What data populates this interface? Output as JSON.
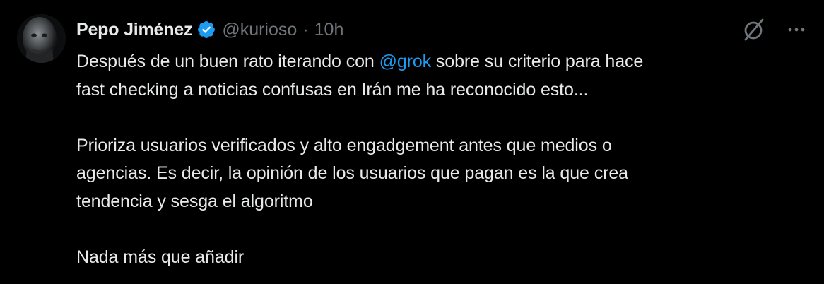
{
  "author": {
    "name": "Pepo Jiménez",
    "handle": "@kurioso",
    "separator": "·",
    "time": "10h"
  },
  "icons": {
    "avatar": "avatar-photo",
    "verified": "verified-badge-icon",
    "grok": "grok-icon",
    "more": "more-icon"
  },
  "colors": {
    "background": "#000000",
    "text": "#e7e9ea",
    "secondary": "#71767b",
    "accent": "#1d9bf0"
  },
  "tweet": {
    "p1_line1_before": "Después de un buen rato iterando con ",
    "p1_mention": "@grok",
    "p1_line1_after": " sobre su criterio para hace",
    "p1_line2": "fast checking a noticias confusas en Irán me ha reconocido esto...",
    "p2_line1": "Prioriza usuarios verificados y alto engadgement antes que medios o",
    "p2_line2": "agencias. Es decir, la opinión de los usuarios que pagan es la que crea",
    "p2_line3": "tendencia y sesga el algoritmo",
    "p3_line1": "Nada más que añadir"
  }
}
